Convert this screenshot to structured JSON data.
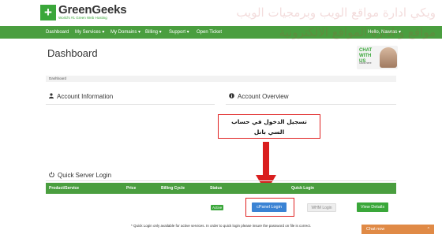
{
  "header": {
    "logo_mark": "+",
    "logo_name": "GreenGeeks",
    "logo_tagline": "World's #1 Green Web Hosting",
    "watermark_line1": "ويكي ادارة مواقع الويب وبرمجيات الويب",
    "watermark_line2": "مواقع و ادارة المواقع الالكترونية"
  },
  "nav": {
    "items": [
      {
        "label": "Dashboard"
      },
      {
        "label": "My Services ▾"
      },
      {
        "label": "My Domains ▾"
      },
      {
        "label": "Billing ▾"
      },
      {
        "label": "Support ▾"
      },
      {
        "label": "Open Ticket"
      }
    ],
    "user_label": "Hello, Nawras ▾"
  },
  "page": {
    "title": "Dashboard",
    "breadcrumb": "Dashboard"
  },
  "chat_badge": {
    "text": "CHAT WITH US",
    "sub": "Click here"
  },
  "sections": {
    "account_info": "Account Information",
    "account_overview": "Account Overview",
    "quick_login": "Quick Server Login"
  },
  "annotation": {
    "line1": "تسجيل الدخول في حساب",
    "line2": "السي بانل"
  },
  "table": {
    "headers": [
      "Product/Service",
      "Price",
      "Billing Cycle",
      "Status",
      "Quick Login"
    ],
    "row": {
      "status": "Active",
      "cpanel_label": "cPanel Login",
      "whm_label": "WHM Login",
      "details_label": "View Details"
    }
  },
  "footnote": "* Quick Login only available for active services. In order to quick login please insure the password on file is correct.",
  "chat_now": {
    "label": "Chat now",
    "caret": "^"
  },
  "colors": {
    "brand_green": "#4a9e3f",
    "button_blue": "#3a83d4",
    "annotation_red": "#e02020",
    "chat_orange": "#e08a46"
  },
  "icons": {
    "account_info": "user-icon",
    "account_overview": "info-circle-icon",
    "quick_login": "power-icon"
  }
}
